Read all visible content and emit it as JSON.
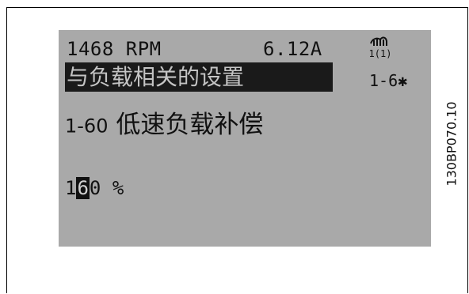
{
  "status": {
    "speed": "1468 RPM",
    "current": "6.12A",
    "mode_icon": "hand-icon",
    "mode_number": "1(1)"
  },
  "menu": {
    "group_title": "与负载相关的设置",
    "group_index": "1-6✱"
  },
  "parameter": {
    "number": "1-60",
    "name": "低速负载补偿",
    "value_prefix": "1",
    "value_cursor": "6",
    "value_suffix": "0",
    "unit": "%"
  },
  "reference": {
    "code": "130BP070.10"
  },
  "colors": {
    "lcd_background": "#a9a9a9",
    "text": "#111111",
    "highlight": "#1a1a1a"
  }
}
